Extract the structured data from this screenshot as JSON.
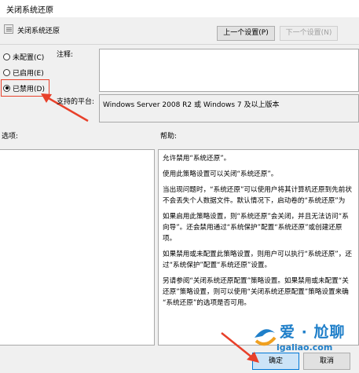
{
  "window": {
    "title": "关闭系统还原"
  },
  "header": {
    "policy_name": "关闭系统还原",
    "prev_setting_label": "上一个设置(P)",
    "next_setting_label": "下一个设置(N)"
  },
  "state": {
    "options": [
      {
        "label": "未配置(C)",
        "selected": false
      },
      {
        "label": "已启用(E)",
        "selected": false
      },
      {
        "label": "已禁用(D)",
        "selected": true
      }
    ]
  },
  "comment": {
    "label": "注释:",
    "value": ""
  },
  "platform": {
    "label": "支持的平台:",
    "value": "Windows Server 2008 R2 或 Windows 7 及以上版本"
  },
  "options_pane": {
    "label": "选项:"
  },
  "help_pane": {
    "label": "帮助:",
    "paragraphs": [
      [
        "允许禁用“系统还原”。"
      ],
      [
        "使用此策略设置可以关闭“系统还原”。"
      ],
      [
        "当出现问题时，“系统还原”可以使用户将其计算机还原到先前状",
        "不会丢失个人数据文件。默认情况下，启动卷的“系统还原”为"
      ],
      [
        "如果启用此策略设置，则“系统还原”会关闭，并且无法访问“系",
        "向导”。还会禁用通过“系统保护”配置“系统还原”或创建还原",
        "项。"
      ],
      [
        "如果禁用或未配置此策略设置，则用户可以执行“系统还原”，还",
        "过“系统保护”配置“系统还原”设置。"
      ],
      [
        "另请参阅“关闭系统还原配置”策略设置。如果禁用或未配置“关",
        "还原”策略设置，则可以使用“关闭系统还原配置”策略设置来确",
        "“系统还原”的选项是否可用。"
      ]
    ]
  },
  "footer": {
    "ok_label": "确定",
    "cancel_label": "取消"
  },
  "watermark": {
    "line1": "爱 · 尬聊",
    "line2": "igaliao.com"
  },
  "colors": {
    "annotation_red": "#e8402a",
    "watermark_blue": "#1f7fc9"
  }
}
